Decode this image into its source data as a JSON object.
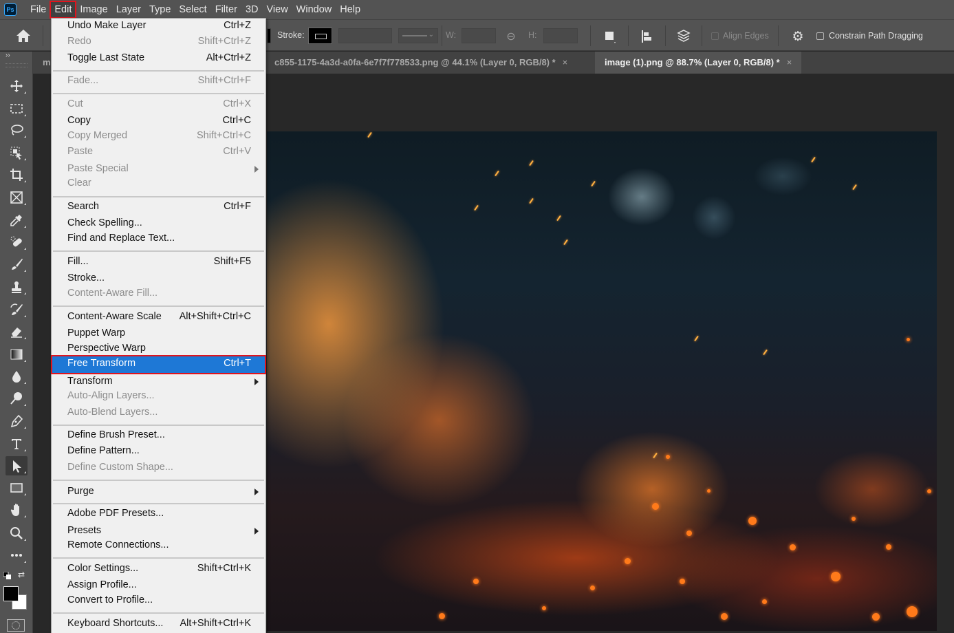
{
  "app": {
    "logo": "Ps"
  },
  "menubar": {
    "items": [
      "File",
      "Edit",
      "Image",
      "Layer",
      "Type",
      "Select",
      "Filter",
      "3D",
      "View",
      "Window",
      "Help"
    ],
    "active_index": 1
  },
  "options_bar": {
    "home_icon": "home-icon",
    "stroke_label": "Stroke:",
    "width_label": "W:",
    "height_label": "H:",
    "link_icon": "link-icon",
    "align_edges_label": "Align Edges",
    "align_edges_checked": false,
    "constrain_label": "Constrain Path Dragging",
    "constrain_checked": false
  },
  "tabs": [
    {
      "label": "m",
      "active": false
    },
    {
      "label": "c855-1175-4a3d-a0fa-6e7f7f778533.png @ 44.1% (Layer 0, RGB/8) *",
      "active": false,
      "close": "×"
    },
    {
      "label": "image (1).png @ 88.7% (Layer 0, RGB/8) *",
      "active": true,
      "close": "×"
    }
  ],
  "toolbar": {
    "collapse": "››",
    "tools": [
      "move-tool",
      "rectangular-marquee-tool",
      "lasso-tool",
      "object-selection-tool",
      "crop-tool",
      "frame-tool",
      "eyedropper-tool",
      "healing-brush-tool",
      "brush-tool",
      "clone-stamp-tool",
      "history-brush-tool",
      "eraser-tool",
      "gradient-tool",
      "blur-tool",
      "dodge-tool",
      "pen-tool",
      "type-tool",
      "path-selection-tool",
      "rectangle-tool",
      "hand-tool",
      "zoom-tool",
      "edit-toolbar"
    ],
    "selected_tool": "path-selection-tool",
    "foreground_color": "#000000",
    "background_color": "#ffffff"
  },
  "edit_menu": {
    "groups": [
      [
        {
          "label": "Undo Make Layer",
          "shortcut": "Ctrl+Z",
          "disabled": false
        },
        {
          "label": "Redo",
          "shortcut": "Shift+Ctrl+Z",
          "disabled": true
        },
        {
          "label": "Toggle Last State",
          "shortcut": "Alt+Ctrl+Z",
          "disabled": false
        }
      ],
      [
        {
          "label": "Fade...",
          "shortcut": "Shift+Ctrl+F",
          "disabled": true
        }
      ],
      [
        {
          "label": "Cut",
          "shortcut": "Ctrl+X",
          "disabled": true
        },
        {
          "label": "Copy",
          "shortcut": "Ctrl+C",
          "disabled": false
        },
        {
          "label": "Copy Merged",
          "shortcut": "Shift+Ctrl+C",
          "disabled": true
        },
        {
          "label": "Paste",
          "shortcut": "Ctrl+V",
          "disabled": true
        },
        {
          "label": "Paste Special",
          "shortcut": "",
          "disabled": true,
          "submenu": true
        },
        {
          "label": "Clear",
          "shortcut": "",
          "disabled": true
        }
      ],
      [
        {
          "label": "Search",
          "shortcut": "Ctrl+F",
          "disabled": false
        },
        {
          "label": "Check Spelling...",
          "shortcut": "",
          "disabled": false
        },
        {
          "label": "Find and Replace Text...",
          "shortcut": "",
          "disabled": false
        }
      ],
      [
        {
          "label": "Fill...",
          "shortcut": "Shift+F5",
          "disabled": false
        },
        {
          "label": "Stroke...",
          "shortcut": "",
          "disabled": false
        },
        {
          "label": "Content-Aware Fill...",
          "shortcut": "",
          "disabled": true
        }
      ],
      [
        {
          "label": "Content-Aware Scale",
          "shortcut": "Alt+Shift+Ctrl+C",
          "disabled": false
        },
        {
          "label": "Puppet Warp",
          "shortcut": "",
          "disabled": false
        },
        {
          "label": "Perspective Warp",
          "shortcut": "",
          "disabled": false
        },
        {
          "label": "Free Transform",
          "shortcut": "Ctrl+T",
          "disabled": false,
          "highlighted": true
        },
        {
          "label": "Transform",
          "shortcut": "",
          "disabled": false,
          "submenu": true
        },
        {
          "label": "Auto-Align Layers...",
          "shortcut": "",
          "disabled": true
        },
        {
          "label": "Auto-Blend Layers...",
          "shortcut": "",
          "disabled": true
        }
      ],
      [
        {
          "label": "Define Brush Preset...",
          "shortcut": "",
          "disabled": false
        },
        {
          "label": "Define Pattern...",
          "shortcut": "",
          "disabled": false
        },
        {
          "label": "Define Custom Shape...",
          "shortcut": "",
          "disabled": true
        }
      ],
      [
        {
          "label": "Purge",
          "shortcut": "",
          "disabled": false,
          "submenu": true
        }
      ],
      [
        {
          "label": "Adobe PDF Presets...",
          "shortcut": "",
          "disabled": false
        },
        {
          "label": "Presets",
          "shortcut": "",
          "disabled": false,
          "submenu": true
        },
        {
          "label": "Remote Connections...",
          "shortcut": "",
          "disabled": false
        }
      ],
      [
        {
          "label": "Color Settings...",
          "shortcut": "Shift+Ctrl+K",
          "disabled": false
        },
        {
          "label": "Assign Profile...",
          "shortcut": "",
          "disabled": false
        },
        {
          "label": "Convert to Profile...",
          "shortcut": "",
          "disabled": false
        }
      ],
      [
        {
          "label": "Keyboard Shortcuts...",
          "shortcut": "Alt+Shift+Ctrl+K",
          "disabled": false
        }
      ]
    ]
  },
  "canvas": {
    "image_description": "Flames and glowing embers over dark ground with blue bokeh background"
  },
  "colors": {
    "highlight": "#1e78d6",
    "annotation_red": "#e0141d",
    "ui_panel": "#535353",
    "canvas_bg": "#282828"
  }
}
